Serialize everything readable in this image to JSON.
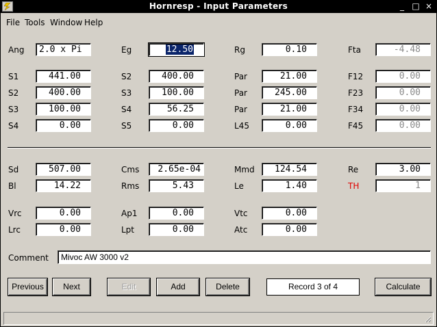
{
  "window": {
    "title": "Hornresp - Input Parameters"
  },
  "titlebar_buttons": {
    "minimize": "_",
    "maximize": "□",
    "close": "×"
  },
  "menu": [
    "File",
    "Tools",
    "Window",
    "Help"
  ],
  "params": {
    "Ang": {
      "label": "Ang",
      "value": "2.0 x Pi"
    },
    "Eg": {
      "label": "Eg",
      "value": "12.50"
    },
    "Rg": {
      "label": "Rg",
      "value": "0.10"
    },
    "Fta": {
      "label": "Fta",
      "value": "-4.48"
    },
    "S1": {
      "label": "S1",
      "value": "441.00"
    },
    "S2b": {
      "label": "S2",
      "value": "400.00"
    },
    "Par1": {
      "label": "Par",
      "value": "21.00"
    },
    "F12": {
      "label": "F12",
      "value": "0.00"
    },
    "S2": {
      "label": "S2",
      "value": "400.00"
    },
    "S3b": {
      "label": "S3",
      "value": "100.00"
    },
    "Par2": {
      "label": "Par",
      "value": "245.00"
    },
    "F23": {
      "label": "F23",
      "value": "0.00"
    },
    "S3": {
      "label": "S3",
      "value": "100.00"
    },
    "S4b": {
      "label": "S4",
      "value": "56.25"
    },
    "Par3": {
      "label": "Par",
      "value": "21.00"
    },
    "F34": {
      "label": "F34",
      "value": "0.00"
    },
    "S4": {
      "label": "S4",
      "value": "0.00"
    },
    "S5": {
      "label": "S5",
      "value": "0.00"
    },
    "L45": {
      "label": "L45",
      "value": "0.00"
    },
    "F45": {
      "label": "F45",
      "value": "0.00"
    },
    "Sd": {
      "label": "Sd",
      "value": "507.00"
    },
    "Cms": {
      "label": "Cms",
      "value": "2.65e-04"
    },
    "Mmd": {
      "label": "Mmd",
      "value": "124.54"
    },
    "Re": {
      "label": "Re",
      "value": "3.00"
    },
    "Bl": {
      "label": "Bl",
      "value": "14.22"
    },
    "Rms": {
      "label": "Rms",
      "value": "5.43"
    },
    "Le": {
      "label": "Le",
      "value": "1.40"
    },
    "TH": {
      "label": "TH",
      "value": "1"
    },
    "Vrc": {
      "label": "Vrc",
      "value": "0.00"
    },
    "Ap1": {
      "label": "Ap1",
      "value": "0.00"
    },
    "Vtc": {
      "label": "Vtc",
      "value": "0.00"
    },
    "Lrc": {
      "label": "Lrc",
      "value": "0.00"
    },
    "Lpt": {
      "label": "Lpt",
      "value": "0.00"
    },
    "Atc": {
      "label": "Atc",
      "value": "0.00"
    }
  },
  "comment": {
    "label": "Comment",
    "value": "Mivoc AW 3000 v2"
  },
  "buttons": {
    "previous": "Previous",
    "next": "Next",
    "edit": "Edit",
    "add": "Add",
    "delete": "Delete",
    "calculate": "Calculate"
  },
  "record": "Record 3 of 4",
  "colors": {
    "selection": "#0a246a",
    "th_label": "#e00000",
    "face": "#d4d0c8"
  }
}
